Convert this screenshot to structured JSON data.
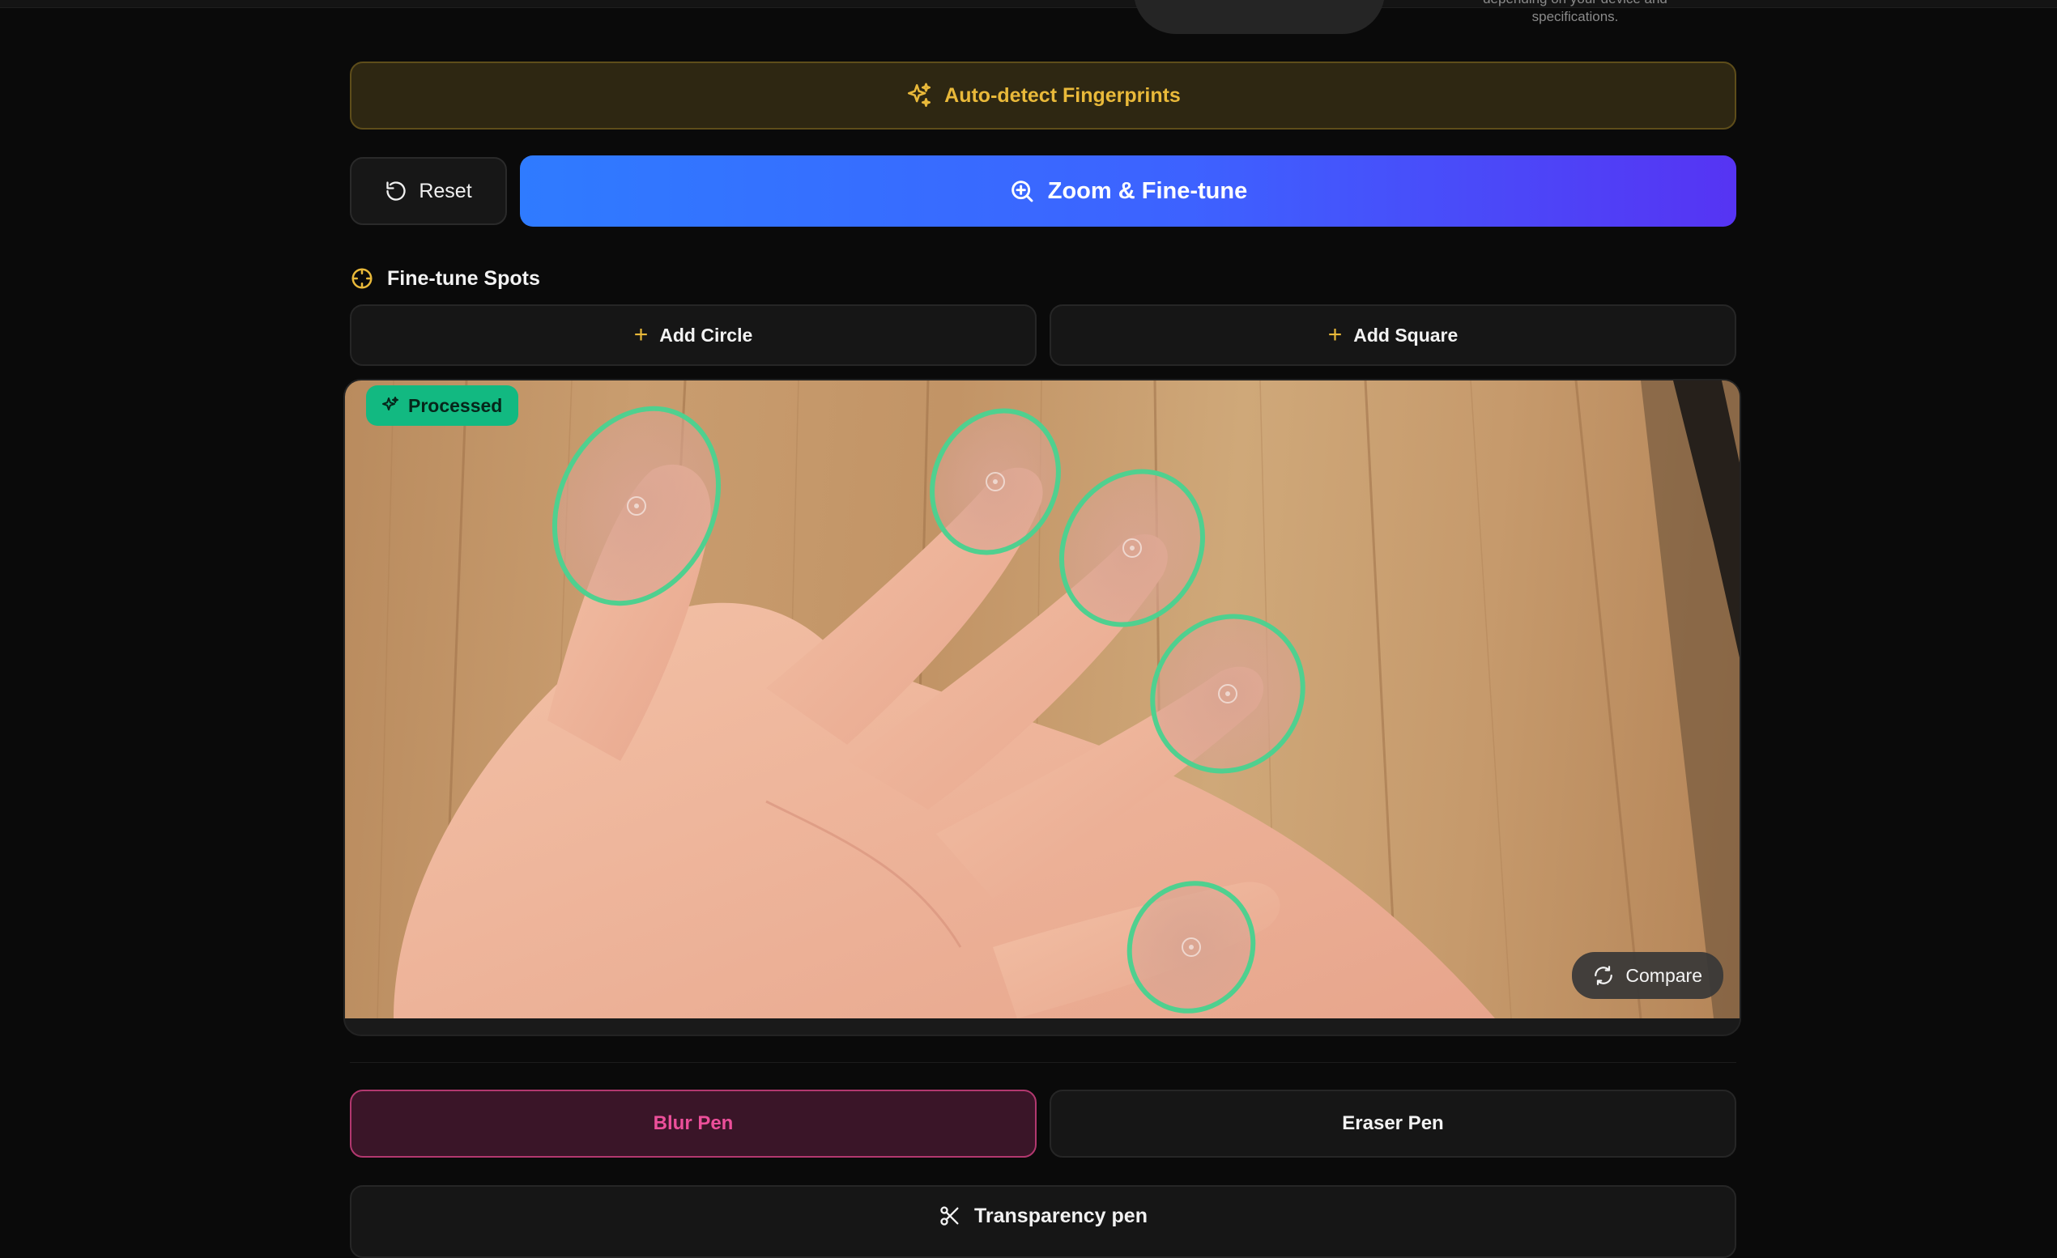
{
  "top": {
    "note_line1": "depending on your device and",
    "note_line2": "specifications."
  },
  "actions": {
    "auto_detect_label": "Auto-detect Fingerprints",
    "reset_label": "Reset",
    "zoom_label": "Zoom & Fine-tune"
  },
  "finetune": {
    "title": "Fine-tune Spots",
    "add_circle_label": "Add Circle",
    "add_square_label": "Add Square"
  },
  "preview": {
    "status_badge": "Processed",
    "compare_label": "Compare",
    "spot_count": 5
  },
  "pens": {
    "blur_label": "Blur Pen",
    "eraser_label": "Eraser Pen",
    "transparency_label": "Transparency pen",
    "active": "Blur Pen"
  },
  "colors": {
    "accent_gold": "#e9b93a",
    "zoom_gradient_start": "#2f7bff",
    "zoom_gradient_end": "#5634f3",
    "processed_green": "#12b981",
    "spot_outline": "#4fd08f",
    "blur_pink": "#ec4f9a"
  },
  "icons": {
    "auto_detect": "sparkles-icon",
    "reset": "rotate-ccw-icon",
    "zoom": "zoom-in-icon",
    "finetune": "crosshair-icon",
    "add": "plus-icon",
    "processed": "sparkles-icon",
    "compare": "refresh-icon",
    "transparency": "scissors-icon"
  }
}
